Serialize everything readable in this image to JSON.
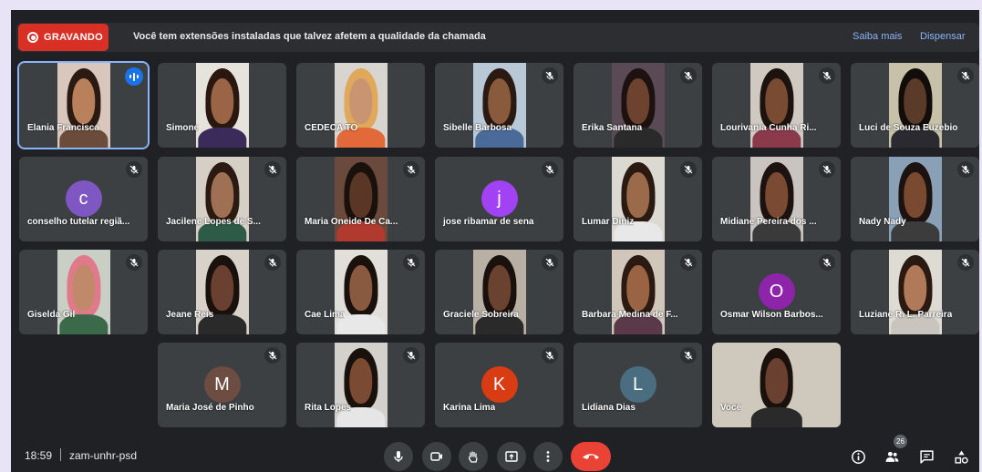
{
  "recording": {
    "label": "GRAVANDO",
    "color": "#d93025"
  },
  "banner": {
    "text": "Você tem extensões instaladas que talvez afetem a qualidade da chamada",
    "learn_more": "Saiba mais",
    "dismiss": "Dispensar"
  },
  "participants": [
    {
      "name": "Elania Francisca",
      "muted": false,
      "speaking": true,
      "type": "video",
      "bg": "#d9c6bc",
      "skin": "#b9805c",
      "hair": "#2b1a12",
      "shirt": "#6b4b3a"
    },
    {
      "name": "Simone",
      "muted": false,
      "type": "video",
      "bg": "#e6e2dc",
      "skin": "#9a6546",
      "hair": "#2a1710",
      "shirt": "#3b2b5a"
    },
    {
      "name": "CEDECA TO",
      "muted": false,
      "type": "video",
      "bg": "#d8d4cf",
      "skin": "#c99472",
      "hair": "#e0a85a",
      "shirt": "#e26a3a"
    },
    {
      "name": "Sibelle Barbosa",
      "muted": true,
      "type": "video",
      "bg": "#b9c8d6",
      "skin": "#8a5a3d",
      "hair": "#2b1a12",
      "shirt": "#4a6a9a"
    },
    {
      "name": "Erika Santana",
      "muted": true,
      "type": "video",
      "bg": "#5a4a55",
      "skin": "#6d4330",
      "hair": "#1e1210",
      "shirt": "#2a2a2a"
    },
    {
      "name": "Lourivania Cunha Ri...",
      "muted": true,
      "type": "video",
      "bg": "#cfc9c2",
      "skin": "#7a4b33",
      "hair": "#1c120e",
      "shirt": "#8a3a4a"
    },
    {
      "name": "Luci de Souza Euzebio",
      "muted": true,
      "type": "video",
      "bg": "#c6c1a8",
      "skin": "#5a3a28",
      "hair": "#120c0a",
      "shirt": "#2a2a30"
    },
    {
      "name": "conselho tutelar regiã...",
      "muted": true,
      "type": "avatar",
      "initial": "c",
      "color": "#7e57c2"
    },
    {
      "name": "Jacilene Lopes de S...",
      "muted": true,
      "type": "video",
      "bg": "#d6cfc6",
      "skin": "#a07054",
      "hair": "#2a1a12",
      "shirt": "#2e5a48"
    },
    {
      "name": "Maria Oneide De Ca...",
      "muted": true,
      "type": "video",
      "bg": "#6a4a3c",
      "skin": "#5a3626",
      "hair": "#1a100c",
      "shirt": "#b03a2e"
    },
    {
      "name": "jose ribamar de sena",
      "muted": true,
      "type": "avatar",
      "initial": "j",
      "color": "#a142f4"
    },
    {
      "name": "Lumar Diniz",
      "muted": true,
      "type": "video",
      "bg": "#dcd8d2",
      "skin": "#9a6a4a",
      "hair": "#2a1a12",
      "shirt": "#e8e8e8"
    },
    {
      "name": "Midiane Pereira dos ...",
      "muted": true,
      "type": "video",
      "bg": "#c9c4bf",
      "skin": "#7a4a32",
      "hair": "#1c1210",
      "shirt": "#3a3a3a"
    },
    {
      "name": "Nady Nady",
      "muted": true,
      "type": "video",
      "bg": "#8aa0b6",
      "skin": "#7a4a30",
      "hair": "#1c1210",
      "shirt": "#3c3c3c"
    },
    {
      "name": "Giselda Gil",
      "muted": true,
      "type": "video",
      "bg": "#c9cfc4",
      "skin": "#c08a6a",
      "hair": "#e07a8a",
      "shirt": "#3a6a4a"
    },
    {
      "name": "Jeane Reis",
      "muted": true,
      "type": "video",
      "bg": "#d8d2ca",
      "skin": "#6a4030",
      "hair": "#1a100c",
      "shirt": "#2a2a2a"
    },
    {
      "name": "Cae Lima",
      "muted": true,
      "type": "video",
      "bg": "#e2dfda",
      "skin": "#8a5a40",
      "hair": "#1a100c",
      "shirt": "#e8e8e8"
    },
    {
      "name": "Graciele Sobreira",
      "muted": true,
      "type": "video",
      "bg": "#b8b0a4",
      "skin": "#6a4230",
      "hair": "#1a100c",
      "shirt": "#2a2a2a"
    },
    {
      "name": "Barbara Medina de F...",
      "muted": true,
      "type": "video",
      "bg": "#d0c6ba",
      "skin": "#9a6444",
      "hair": "#2a1a12",
      "shirt": "#5a3a4a"
    },
    {
      "name": "Osmar Wilson Barbos...",
      "muted": true,
      "type": "avatar",
      "initial": "O",
      "color": "#8e24aa"
    },
    {
      "name": "Luziane R. L. Parreira",
      "muted": true,
      "type": "video",
      "bg": "#dedad4",
      "skin": "#b07a5a",
      "hair": "#2a1a12",
      "shirt": "#c9c4be"
    },
    {
      "name": "Maria José de Pinho",
      "muted": true,
      "type": "avatar",
      "initial": "M",
      "color": "#6d4c41"
    },
    {
      "name": "Rita Lopes",
      "muted": true,
      "type": "video",
      "bg": "#d4d0cc",
      "skin": "#7a4a32",
      "hair": "#1a100c",
      "shirt": "#e6e6e6"
    },
    {
      "name": "Karina Lima",
      "muted": true,
      "type": "avatar",
      "initial": "K",
      "color": "#d93b13"
    },
    {
      "name": "Lidiana Dias",
      "muted": true,
      "type": "avatar",
      "initial": "L",
      "color": "#4a6d80"
    },
    {
      "name": "Você",
      "muted": false,
      "type": "video",
      "bg": "#cfc8bc",
      "skin": "#6a4030",
      "hair": "#1a100c",
      "shirt": "#2a2a2a"
    }
  ],
  "footer": {
    "time": "18:59",
    "meeting_code": "zam-unhr-psd",
    "participant_count": "26",
    "hangup_color": "#ea4335"
  }
}
